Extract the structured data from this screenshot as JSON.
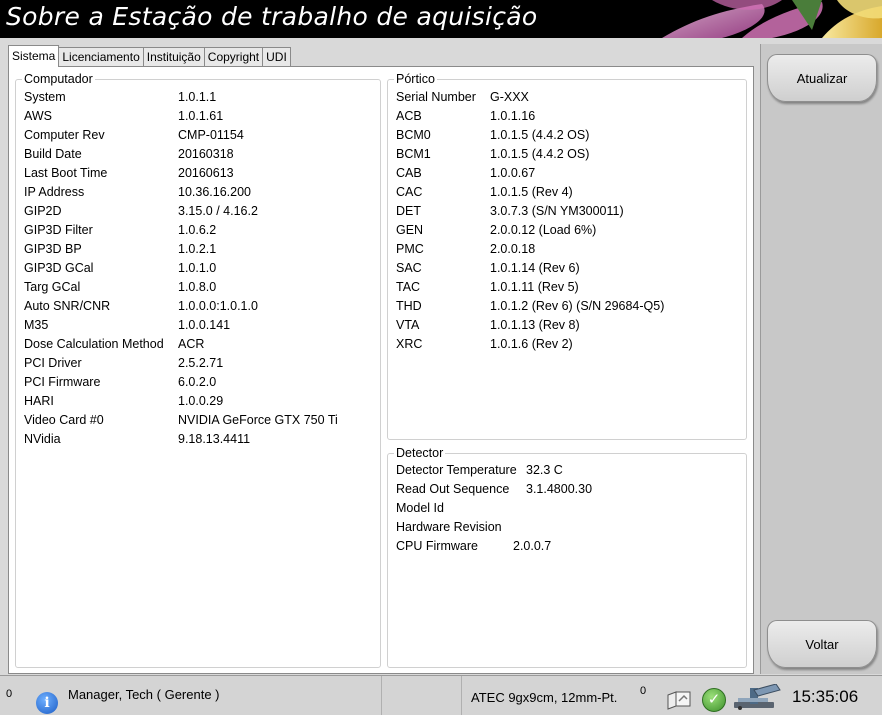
{
  "window": {
    "title": "Sobre a Estação de trabalho de aquisição"
  },
  "tabs": [
    {
      "label": "Sistema",
      "active": true
    },
    {
      "label": "Licenciamento",
      "active": false
    },
    {
      "label": "Instituição",
      "active": false
    },
    {
      "label": "Copyright",
      "active": false
    },
    {
      "label": "UDI",
      "active": false
    }
  ],
  "computador": {
    "legend": "Computador",
    "rows": [
      {
        "k": "System",
        "v": "1.0.1.1"
      },
      {
        "k": "AWS",
        "v": "1.0.1.61"
      },
      {
        "k": "Computer Rev",
        "v": "CMP-01154"
      },
      {
        "k": "Build Date",
        "v": "20160318"
      },
      {
        "k": "Last Boot Time",
        "v": "20160613"
      },
      {
        "k": "IP Address",
        "v": "10.36.16.200"
      },
      {
        "k": "GIP2D",
        "v": "3.15.0 / 4.16.2"
      },
      {
        "k": "GIP3D Filter",
        "v": "1.0.6.2"
      },
      {
        "k": "GIP3D BP",
        "v": "1.0.2.1"
      },
      {
        "k": "GIP3D GCal",
        "v": "1.0.1.0"
      },
      {
        "k": "Targ GCal",
        "v": "1.0.8.0"
      },
      {
        "k": "Auto SNR/CNR",
        "v": "1.0.0.0:1.0.1.0"
      },
      {
        "k": "M35",
        "v": "1.0.0.141"
      },
      {
        "k": "Dose Calculation Method",
        "v": "ACR"
      },
      {
        "k": "PCI Driver",
        "v": "2.5.2.71"
      },
      {
        "k": "PCI Firmware",
        "v": "6.0.2.0"
      },
      {
        "k": "HARI",
        "v": "1.0.0.29"
      },
      {
        "k": "Video Card #0",
        "v": "NVIDIA GeForce GTX 750 Ti"
      },
      {
        "k": "NVidia",
        "v": "9.18.13.4411"
      }
    ]
  },
  "portico": {
    "legend": "Pórtico",
    "rows": [
      {
        "k": "Serial Number",
        "v": "G-XXX"
      },
      {
        "k": "ACB",
        "v": "1.0.1.16"
      },
      {
        "k": "BCM0",
        "v": "1.0.1.5  (4.4.2 OS)"
      },
      {
        "k": "BCM1",
        "v": "1.0.1.5  (4.4.2 OS)"
      },
      {
        "k": "CAB",
        "v": "1.0.0.67"
      },
      {
        "k": "CAC",
        "v": "1.0.1.5  (Rev 4)"
      },
      {
        "k": "DET",
        "v": "3.0.7.3  (S/N YM300011)"
      },
      {
        "k": "GEN",
        "v": "2.0.0.12  (Load 6%)"
      },
      {
        "k": "PMC",
        "v": "2.0.0.18"
      },
      {
        "k": "SAC",
        "v": "1.0.1.14  (Rev 6)"
      },
      {
        "k": "TAC",
        "v": "1.0.1.11  (Rev 5)"
      },
      {
        "k": "THD",
        "v": "1.0.1.2  (Rev 6)  (S/N 29684-Q5)"
      },
      {
        "k": "VTA",
        "v": "1.0.1.13  (Rev 8)"
      },
      {
        "k": "XRC",
        "v": "1.0.1.6  (Rev 2)"
      }
    ]
  },
  "detector": {
    "legend": "Detector",
    "rows": [
      {
        "k": "Detector Temperature",
        "v": "32.3 C"
      },
      {
        "k": "Read Out Sequence",
        "v": "3.1.4800.30"
      },
      {
        "k": "Model Id",
        "v": ""
      },
      {
        "k": "Hardware Revision",
        "v": ""
      },
      {
        "k": "CPU Firmware",
        "v": "2.0.0.7"
      }
    ]
  },
  "side_buttons": {
    "refresh": "Atualizar",
    "back": "Voltar"
  },
  "statusbar": {
    "left_count": "0",
    "user": "Manager, Tech ( Gerente )",
    "paddle": "ATEC 9gx9cm, 12mm-Pt.",
    "right_count": "0",
    "time": "15:35:06",
    "icons": [
      "info-icon",
      "tray-icon",
      "check-icon",
      "xray-tube-icon"
    ]
  }
}
